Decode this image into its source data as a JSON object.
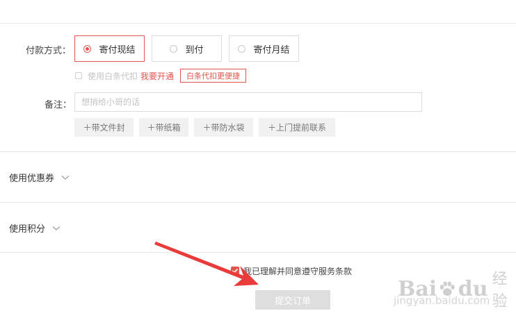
{
  "payment": {
    "label": "付款方式：",
    "options": [
      {
        "label": "寄付现结",
        "selected": true
      },
      {
        "label": "到付",
        "selected": false
      },
      {
        "label": "寄付月结",
        "selected": false
      }
    ]
  },
  "baitiao": {
    "text": "使用白条代扣",
    "link": "我要开通",
    "tag": "白条代扣更便捷"
  },
  "remark": {
    "label": "备注：",
    "placeholder": "想捎给小哥的话",
    "chips": [
      "＋带文件封",
      "＋带纸箱",
      "＋带防水袋",
      "＋上门提前联系"
    ]
  },
  "coupon": {
    "title": "使用优惠券"
  },
  "points": {
    "title": "使用积分"
  },
  "agreement": {
    "text": "我已理解并同意遵守服务条款",
    "checked": true
  },
  "submit": {
    "label": "提交订单"
  },
  "watermark": {
    "logo": "Bai",
    "logo_tail": "du",
    "cn": "经验",
    "url": "jingyan.baidu.com"
  },
  "colors": {
    "accent": "#e2554f",
    "disabled_button": "#dedede",
    "chip_bg": "#f1f1f1",
    "annotation_arrow": "#ea3b3b"
  }
}
